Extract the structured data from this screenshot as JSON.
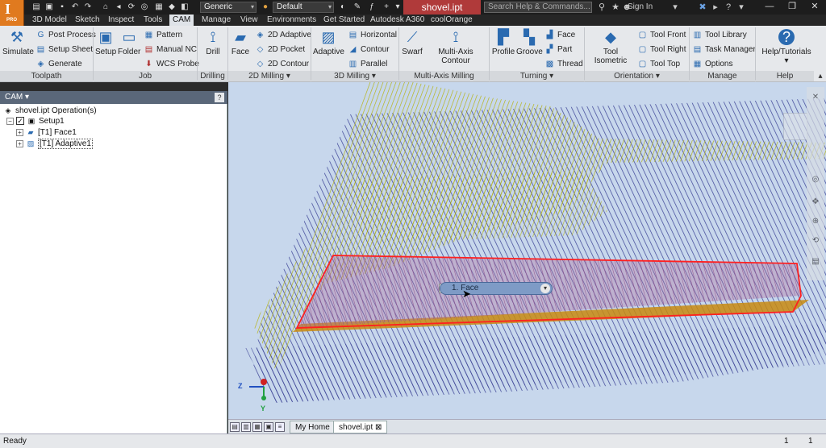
{
  "titlebar": {
    "logo_letter": "I",
    "logo_sub": "PRO",
    "material_value": "Generic",
    "appearance_value": "Default",
    "document_title": "shovel.ipt",
    "search_placeholder": "Search Help & Commands...",
    "sign_in": "Sign In"
  },
  "tabs": [
    "3D Model",
    "Sketch",
    "Inspect",
    "Tools",
    "CAM",
    "Manage",
    "View",
    "Environments",
    "Get Started",
    "Autodesk A360",
    "coolOrange"
  ],
  "active_tab": "CAM",
  "ribbon": {
    "toolpath": {
      "title": "Toolpath",
      "simulate": "Simulate",
      "post_process": "Post Process",
      "setup_sheet": "Setup Sheet",
      "generate": "Generate"
    },
    "job": {
      "title": "Job",
      "setup": "Setup",
      "folder": "Folder",
      "pattern": "Pattern",
      "manual_nc": "Manual NC",
      "wcs_probe": "WCS Probe"
    },
    "drilling": {
      "title": "Drilling",
      "drill": "Drill"
    },
    "milling2d": {
      "title": "2D Milling",
      "face": "Face",
      "adaptive2d": "2D Adaptive",
      "pocket2d": "2D Pocket",
      "contour2d": "2D Contour"
    },
    "milling3d": {
      "title": "3D Milling",
      "adaptive": "Adaptive",
      "horizontal": "Horizontal",
      "contour": "Contour",
      "parallel": "Parallel"
    },
    "multiaxis": {
      "title": "Multi-Axis Milling",
      "swarf": "Swarf",
      "multi_axis_contour": "Multi-Axis Contour"
    },
    "turning": {
      "title": "Turning",
      "profile": "Profile",
      "groove": "Groove",
      "face": "Face",
      "part": "Part",
      "thread": "Thread"
    },
    "orientation": {
      "title": "Orientation",
      "tool_isometric": "Tool Isometric",
      "tool_front": "Tool Front",
      "tool_right": "Tool Right",
      "tool_top": "Tool Top"
    },
    "manage": {
      "title": "Manage",
      "tool_library": "Tool Library",
      "task_manager": "Task Manager",
      "options": "Options"
    },
    "help": {
      "title": "Help",
      "help_tutorials": "Help/Tutorials"
    }
  },
  "browser": {
    "title": "CAM",
    "help": "?",
    "tree": {
      "root": "shovel.ipt Operation(s)",
      "setup": "Setup1",
      "op1": "[T1] Face1",
      "op2": "[T1] Adaptive1"
    }
  },
  "viewport": {
    "operation_label": "1. Face",
    "axis_z": "Z",
    "axis_y": "Y"
  },
  "doc_tabs": {
    "home": "My Home",
    "file": "shovel.ipt",
    "close": "⊠"
  },
  "status": {
    "text": "Ready",
    "count1": "1",
    "count2": "1"
  },
  "colors": {
    "toolpath_yellow": "#b5b000",
    "toolpath_blue": "#2a2f8a",
    "selection_red": "#ff2020",
    "viewport_bg": "#c7d7ec",
    "highlight_pink": "#b06a9a"
  }
}
